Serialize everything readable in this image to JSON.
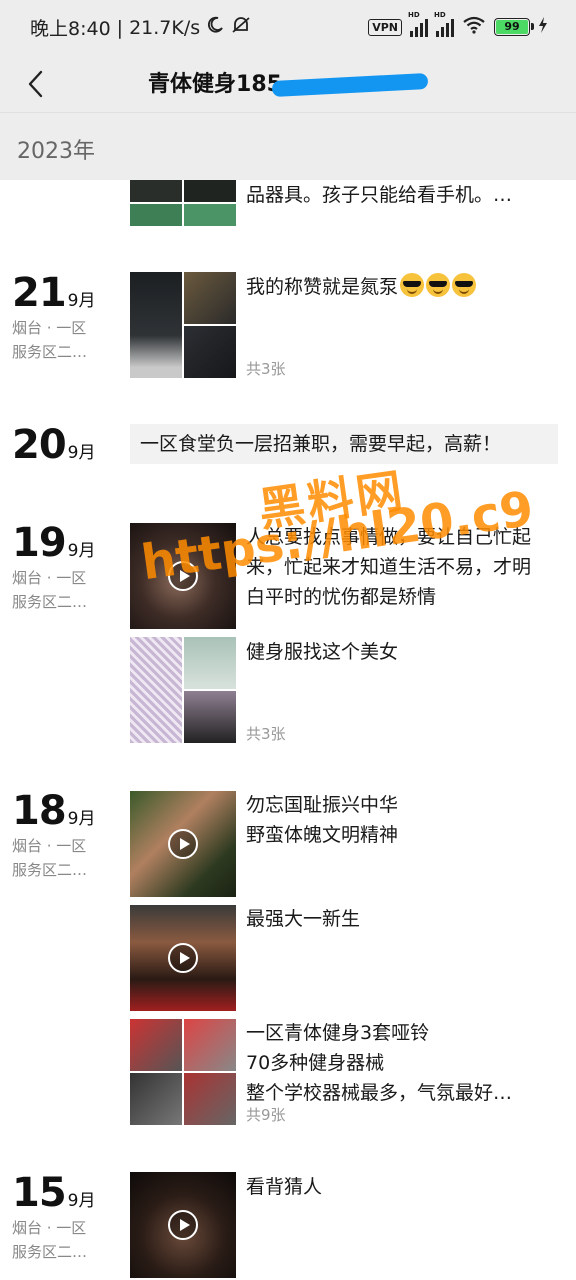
{
  "status_bar": {
    "time": "晚上8:40",
    "speed": "21.7K/s",
    "vpn": "VPN",
    "hd1": "HD",
    "hd2": "HD",
    "battery": "99",
    "icons": [
      "moon-icon",
      "mute-icon",
      "vpn-icon",
      "signal-icon",
      "signal-icon",
      "wifi-icon",
      "battery-icon",
      "charging-icon"
    ]
  },
  "header": {
    "title": "青体健身185",
    "back_icon": "chevron-left-icon"
  },
  "year_label": "2023年",
  "colors": {
    "header_bg": "#ededed",
    "watermark": "#ff8c00",
    "redaction": "#1296f2"
  },
  "top_partial": {
    "text": "品器具。孩子只能给看手机。…"
  },
  "posts": [
    {
      "day": "21",
      "month": "9月",
      "loc1": "烟台 · 一区",
      "loc2": "服务区二…",
      "entries": [
        {
          "text": "我的称赞就是氮泵",
          "emoji_count": 3,
          "count": "共3张"
        }
      ]
    },
    {
      "day": "20",
      "month": "9月",
      "entries": [
        {
          "text": "一区食堂负一层招兼职，需要早起，高薪！"
        }
      ]
    },
    {
      "day": "19",
      "month": "9月",
      "loc1": "烟台 · 一区",
      "loc2": "服务区二…",
      "entries": [
        {
          "text": "人总要找点事情做，要让自己忙起来，忙起来才知道生活不易，才明白平时的忧伤都是矫情"
        },
        {
          "text": "健身服找这个美女",
          "count": "共3张"
        }
      ]
    },
    {
      "day": "18",
      "month": "9月",
      "loc1": "烟台 · 一区",
      "loc2": "服务区二…",
      "entries": [
        {
          "text1": "勿忘国耻振兴中华",
          "text2": "野蛮体魄文明精神"
        },
        {
          "text": "最强大一新生"
        },
        {
          "text1": "一区青体健身3套哑铃",
          "text2": "70多种健身器械",
          "text3": "整个学校器械最多，气氛最好…",
          "count": "共9张"
        }
      ]
    },
    {
      "day": "15",
      "month": "9月",
      "loc1": "烟台 · 一区",
      "loc2": "服务区二…",
      "entries": [
        {
          "text": "看背猜人"
        }
      ]
    }
  ],
  "watermark": {
    "line1": "黑料网",
    "line2": "https://hl20.c9"
  }
}
